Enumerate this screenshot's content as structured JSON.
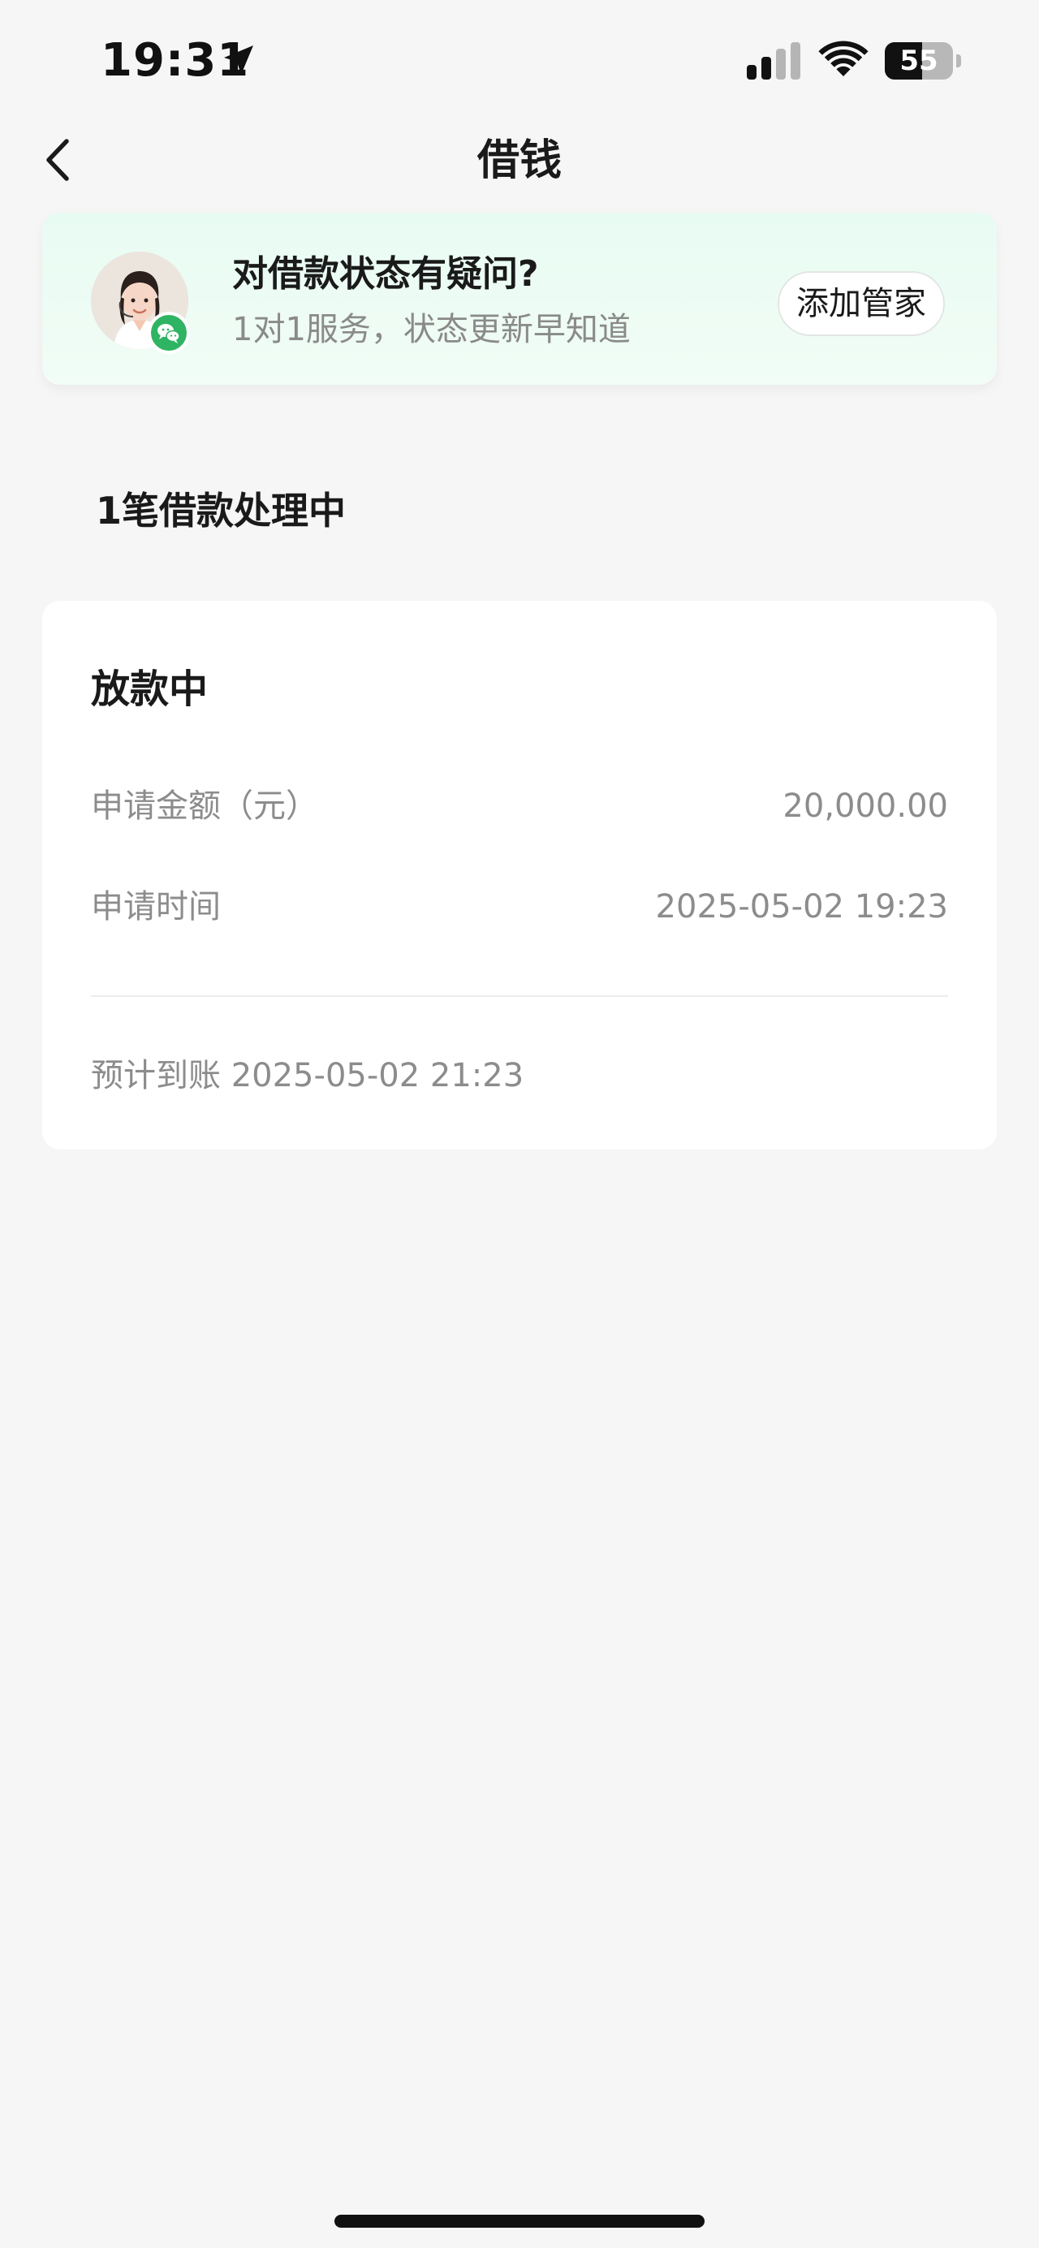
{
  "status_bar": {
    "time": "19:31",
    "battery_level": "55",
    "battery_fraction": 0.55,
    "icons": [
      "location-arrow-icon",
      "cellular-signal-icon",
      "wifi-icon",
      "battery-icon"
    ]
  },
  "nav": {
    "title": "借钱",
    "back_icon": "chevron-left-icon"
  },
  "service_banner": {
    "title": "对借款状态有疑问?",
    "subtitle": "1对1服务，状态更新早知道",
    "button_label": "添加管家",
    "accent_color": "#2fb463",
    "icons": [
      "avatar-image",
      "wechat-icon"
    ]
  },
  "loans": {
    "heading": "1笔借款处理中",
    "card": {
      "status": "放款中",
      "amount_label": "申请金额（元）",
      "amount_value": "20,000.00",
      "time_label": "申请时间",
      "time_value": "2025-05-02 19:23",
      "arrival_text": "预计到账 2025-05-02 21:23"
    }
  }
}
